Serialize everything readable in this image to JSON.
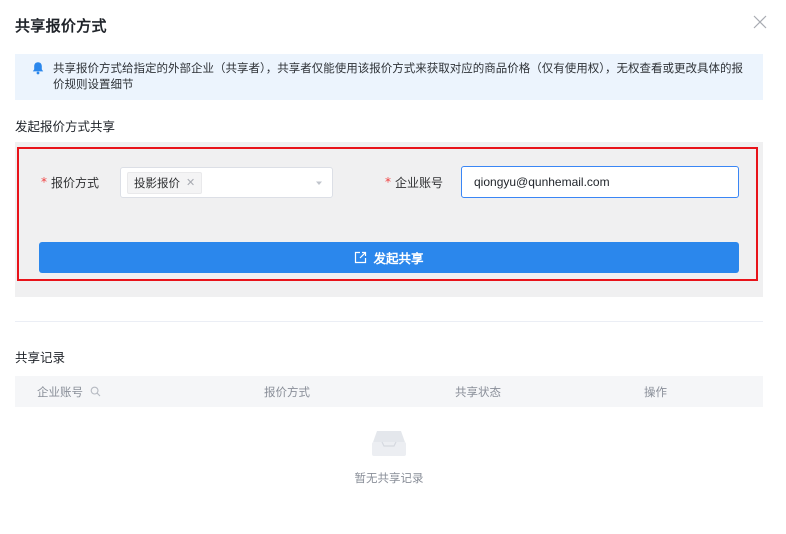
{
  "dialog": {
    "title": "共享报价方式"
  },
  "notice": {
    "text": "共享报价方式给指定的外部企业（共享者），共享者仅能使用该报价方式来获取对应的商品价格（仅有使用权），无权查看或更改具体的报价规则设置细节"
  },
  "initiate": {
    "section_title": "发起报价方式共享",
    "required_mark": "*",
    "method_label": "报价方式",
    "method_selected_tag": "投影报价",
    "account_label": "企业账号",
    "account_value": "qiongyu@qunhemail.com",
    "share_button_label": "发起共享"
  },
  "records": {
    "section_title": "共享记录",
    "columns": [
      "企业账号",
      "报价方式",
      "共享状态",
      "操作"
    ],
    "rows": [],
    "empty_text": "暂无共享记录"
  },
  "colors": {
    "primary": "#2b87ec",
    "highlight": "#e8131a",
    "required": "#f04141",
    "notice_bg": "#ecf4fd"
  },
  "icons": [
    "close-icon",
    "bell-icon",
    "tag-close-icon",
    "chevron-down-icon",
    "external-link-icon",
    "search-icon",
    "empty-box-icon"
  ]
}
